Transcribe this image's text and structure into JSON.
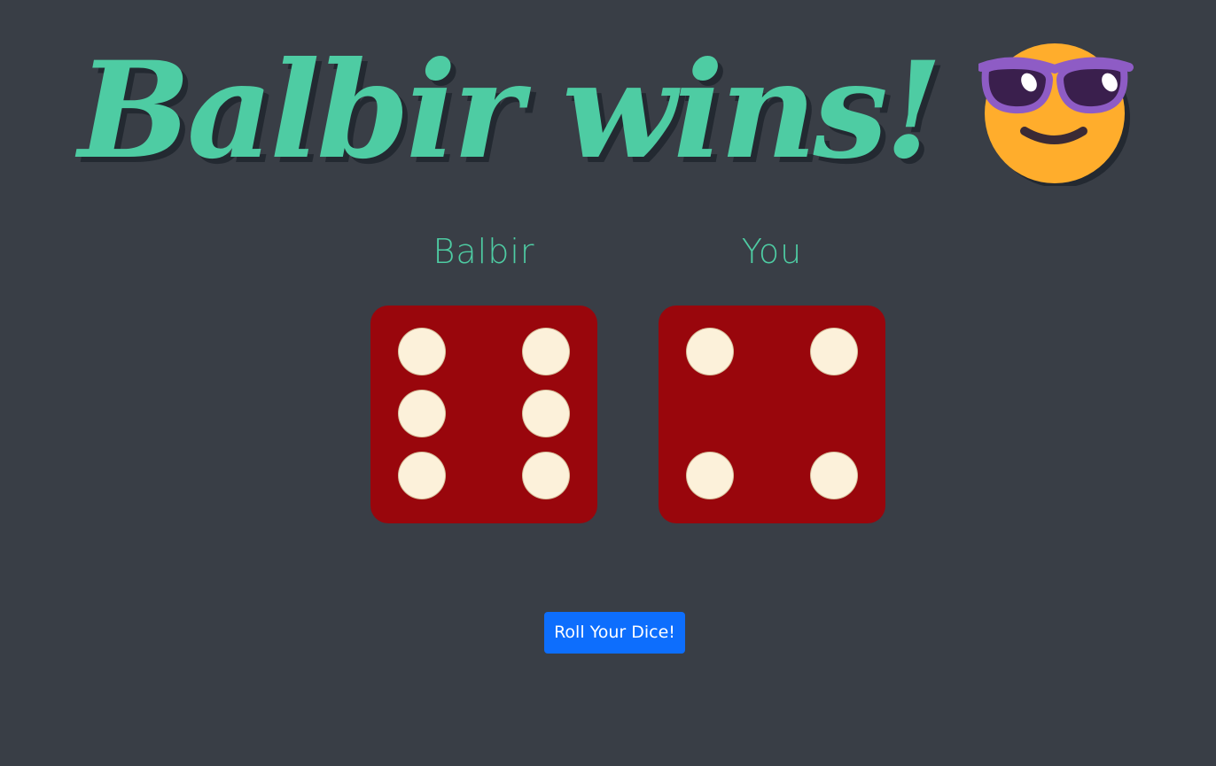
{
  "title": "Balbir wins!",
  "emoji_icon": "smiling-face-with-sunglasses",
  "players": [
    {
      "name": "Balbir",
      "die_value": 6
    },
    {
      "name": "You",
      "die_value": 4
    }
  ],
  "roll_button_label": "Roll Your Dice!",
  "colors": {
    "background": "#393e46",
    "accent": "#4ecca3",
    "die_face": "#99060c",
    "pip": "#fcf1da",
    "button": "#0d6efd"
  }
}
